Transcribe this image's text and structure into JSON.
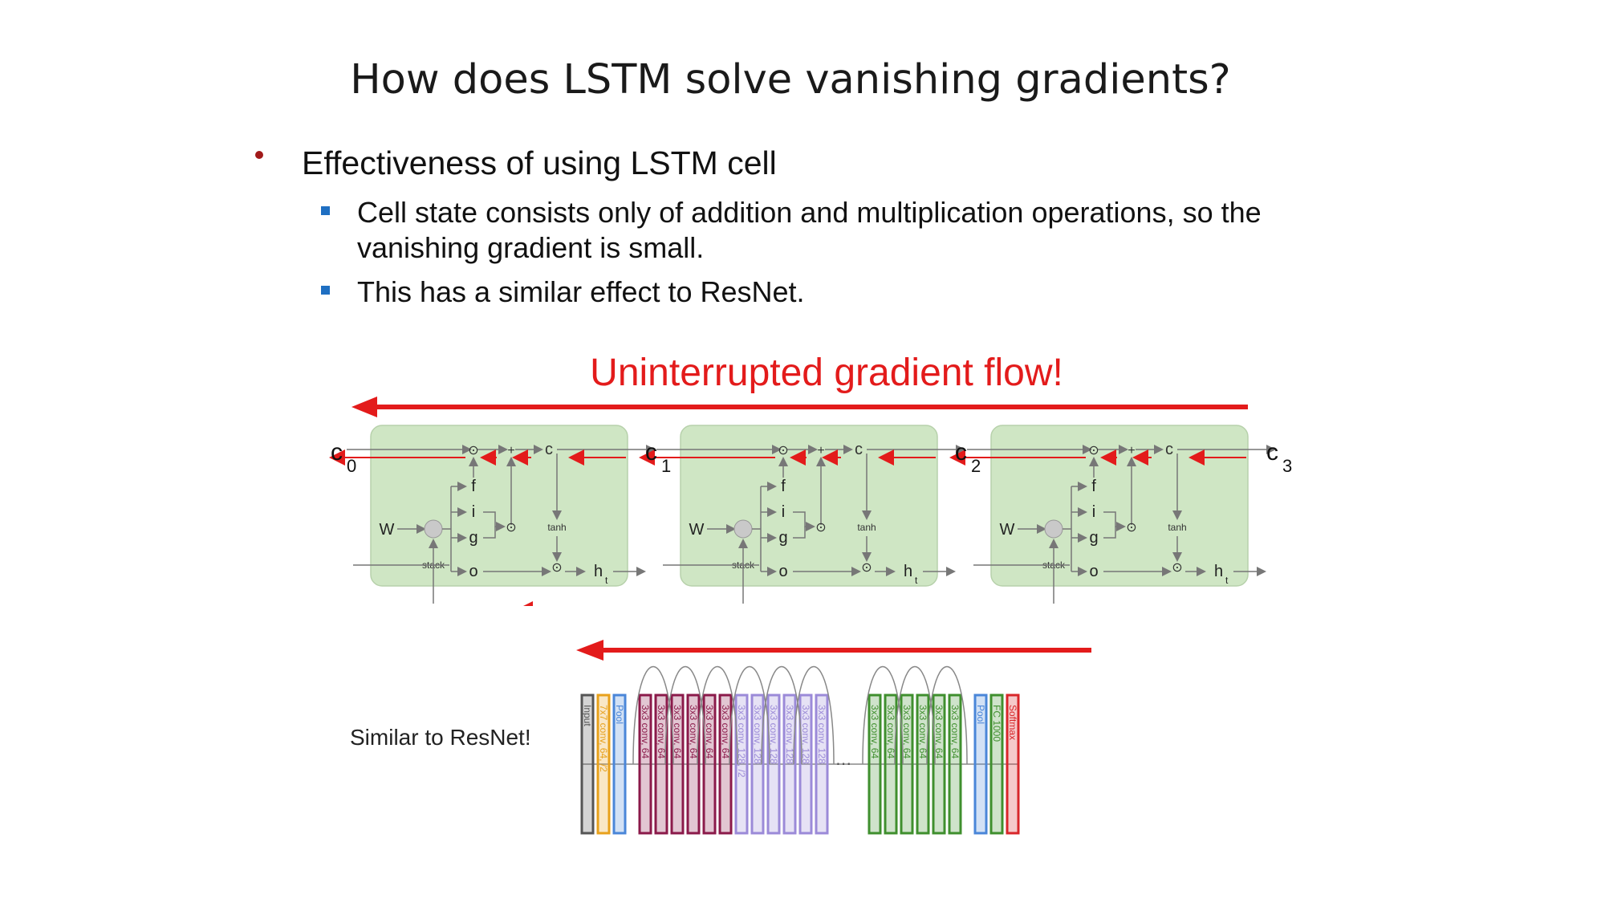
{
  "title": "How does LSTM solve vanishing gradients?",
  "bullets": {
    "main": "Effectiveness of using LSTM cell",
    "sub": [
      "Cell state consists only of addition and multiplication operations, so the vanishing gradient is small.",
      "This has a similar effect to ResNet."
    ]
  },
  "lstm": {
    "banner": "Uninterrupted gradient flow!",
    "cell_labels": [
      "c",
      "0",
      "1",
      "2",
      "3"
    ],
    "w_label": "W",
    "gates": [
      "f",
      "i",
      "g",
      "o"
    ],
    "stack_label": "stack",
    "tanh_label": "tanh",
    "c_label": "c",
    "h_label": "h",
    "t_sub": "t",
    "plus": "+",
    "dot": "⊙"
  },
  "resnet": {
    "caption": "Similar to ResNet!",
    "layers": [
      {
        "label": "Input",
        "color": "#555555"
      },
      {
        "label": "7x7 conv, 64, /2",
        "color": "#e8a11b"
      },
      {
        "label": "Pool",
        "color": "#4a86d8"
      },
      {
        "label": "3x3 conv, 64",
        "color": "#8b1a4a"
      },
      {
        "label": "3x3 conv, 64",
        "color": "#8b1a4a"
      },
      {
        "label": "3x3 conv, 64",
        "color": "#8b1a4a"
      },
      {
        "label": "3x3 conv, 64",
        "color": "#8b1a4a"
      },
      {
        "label": "3x3 conv, 64",
        "color": "#8b1a4a"
      },
      {
        "label": "3x3 conv, 64",
        "color": "#8b1a4a"
      },
      {
        "label": "3x3 conv, 128, /2",
        "color": "#9b8ad8"
      },
      {
        "label": "3x3 conv, 128",
        "color": "#9b8ad8"
      },
      {
        "label": "3x3 conv, 128",
        "color": "#9b8ad8"
      },
      {
        "label": "3x3 conv, 128",
        "color": "#9b8ad8"
      },
      {
        "label": "3x3 conv, 128",
        "color": "#9b8ad8"
      },
      {
        "label": "3x3 conv, 128",
        "color": "#9b8ad8"
      },
      {
        "label": "3x3 conv, 64",
        "color": "#3f8f2e"
      },
      {
        "label": "3x3 conv, 64",
        "color": "#3f8f2e"
      },
      {
        "label": "3x3 conv, 64",
        "color": "#3f8f2e"
      },
      {
        "label": "3x3 conv, 64",
        "color": "#3f8f2e"
      },
      {
        "label": "3x3 conv, 64",
        "color": "#3f8f2e"
      },
      {
        "label": "3x3 conv, 64",
        "color": "#3f8f2e"
      },
      {
        "label": "Pool",
        "color": "#4a86d8"
      },
      {
        "label": "FC 1000",
        "color": "#3f8f2e"
      },
      {
        "label": "Softmax",
        "color": "#d8262a"
      }
    ]
  },
  "colors": {
    "arrow_red": "#e31b1b",
    "cell_green": "#cfe6c4",
    "bullet_red": "#a11a1a",
    "bullet_blue": "#1f6fc2"
  }
}
